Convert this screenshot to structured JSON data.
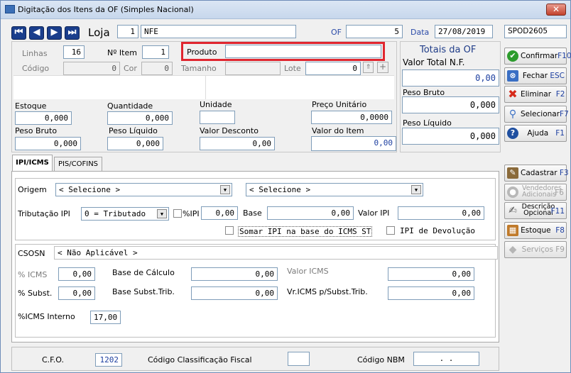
{
  "window": {
    "title": "Digitação dos Itens da OF (Simples Nacional)",
    "close": "✕"
  },
  "top": {
    "loja_label": "Loja",
    "loja_num": "1",
    "loja_name": "NFE",
    "of_label": "OF",
    "of_value": "5",
    "data_label": "Data",
    "data_value": "27/08/2019",
    "code": "SPOD2605"
  },
  "row1": {
    "linhas_label": "Linhas",
    "linhas_value": "16",
    "nitem_label": "Nº Item",
    "nitem_value": "1",
    "produto_label": "Produto",
    "produto_value": ""
  },
  "row2": {
    "codigo_label": "Código",
    "codigo_value": "0",
    "cor_label": "Cor",
    "cor_value": "0",
    "tamanho_label": "Tamanho",
    "tamanho_value": "",
    "lote_label": "Lote",
    "lote_value": "0"
  },
  "fields": {
    "estoque_label": "Estoque",
    "estoque_value": "0,000",
    "quantidade_label": "Quantidade",
    "quantidade_value": "0,000",
    "unidade_label": "Unidade",
    "unidade_value": "",
    "preco_label": "Preço Unitário",
    "preco_value": "0,0000",
    "pbruto_label": "Peso Bruto",
    "pbruto_value": "0,000",
    "pliquido_label": "Peso Líquido",
    "pliquido_value": "0,000",
    "vdesc_label": "Valor Desconto",
    "vdesc_value": "0,00",
    "vitem_label": "Valor do Item",
    "vitem_value": "0,00"
  },
  "totais": {
    "title": "Totais da OF",
    "vtotal_label": "Valor Total N.F.",
    "vtotal_value": "0,00",
    "pbruto_label": "Peso Bruto",
    "pbruto_value": "0,000",
    "pliquido_label": "Peso Líquido",
    "pliquido_value": "0,000"
  },
  "buttons": {
    "confirmar": "Confirmar",
    "confirmar_key": "F10",
    "fechar": "Fechar",
    "fechar_key": "ESC",
    "eliminar": "Eliminar",
    "eliminar_key": "F2",
    "selecionar": "Selecionar",
    "selecionar_key": "F7",
    "ajuda": "Ajuda",
    "ajuda_key": "F1",
    "cadastrar": "Cadastrar",
    "cadastrar_key": "F3",
    "vendedores_1": "Vendedores",
    "vendedores_2": "Adicionais",
    "vendedores_key": "F6",
    "descricao_1": "Descrição",
    "descricao_2": "Opcional",
    "descricao_key": "F11",
    "estoque": "Estoque",
    "estoque_key": "F8",
    "servicos": "Serviços",
    "servicos_key": "F9"
  },
  "tabs": [
    {
      "label": "IPI/ICMS"
    },
    {
      "label": "PIS/COFINS"
    }
  ],
  "ipi": {
    "origem_label": "Origem",
    "origem_sel1": "< Selecione >",
    "origem_sel2": "< Selecione >",
    "trib_label": "Tributação IPI",
    "trib_value": "0 = Tributado",
    "pipi_label": "%IPI",
    "pipi_value": "0,00",
    "base_label": "Base",
    "base_value": "0,00",
    "vipi_label": "Valor IPI",
    "vipi_value": "0,00",
    "somar_label": "Somar IPI na base do ICMS ST",
    "devolucao_label": "IPI de Devolução"
  },
  "icms": {
    "csosn_label": "CSOSN",
    "csosn_value": "< Não Aplicável >",
    "picms_label": "% ICMS",
    "picms_value": "0,00",
    "bcalc_label": "Base de Cálculo",
    "bcalc_value": "0,00",
    "vicms_label": "Valor ICMS",
    "vicms_value": "0,00",
    "psubst_label": "% Subst.",
    "psubst_value": "0,00",
    "bsubst_label": "Base Subst.Trib.",
    "bsubst_value": "0,00",
    "vrsubst_label": "Vr.ICMS p/Subst.Trib.",
    "vrsubst_value": "0,00",
    "interno_label": "%ICMS Interno",
    "interno_value": "17,00"
  },
  "bottom": {
    "cfo_label": "C.F.O.",
    "cfo_value": "1202",
    "ccf_label": "Código Classificação Fiscal",
    "ccf_value": "",
    "nbm_label": "Código NBM",
    "nbm_value": ". ."
  }
}
